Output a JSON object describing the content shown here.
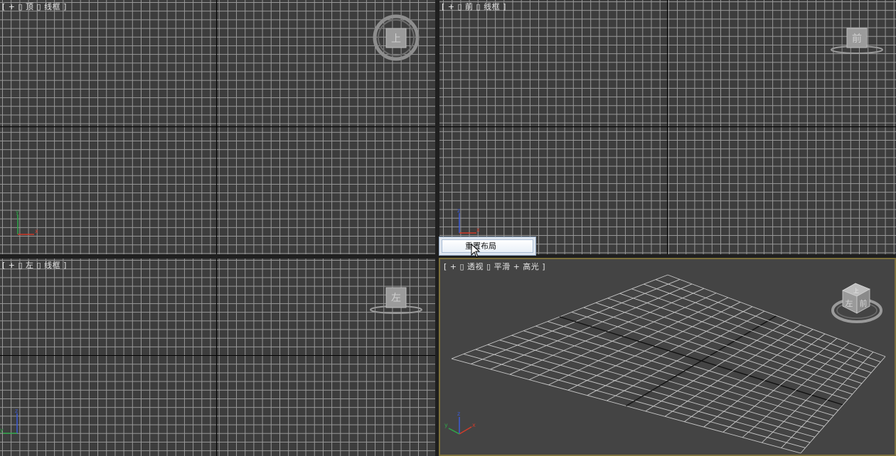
{
  "viewports": {
    "top": {
      "label": "[ + ▯ 顶 ▯ 线框 ]",
      "viewcube_face": "上"
    },
    "front": {
      "label": "[ + ▯ 前 ▯ 线框 ]",
      "viewcube_face": "前"
    },
    "left": {
      "label": "[ + ▯ 左 ▯ 线框 ]",
      "viewcube_face": "左"
    },
    "perspective": {
      "label": "[ + ▯ 透视 ▯ 平滑 + 高光 ]",
      "viewcube_face_front": "前",
      "viewcube_face_left": "左",
      "viewcube_face_top": "上"
    }
  },
  "context_menu": {
    "item": "重置布局"
  },
  "axis_labels": {
    "x": "x",
    "y": "y",
    "z": "z"
  },
  "colors": {
    "x_axis": "#d23b2a",
    "y_axis": "#2fa84a",
    "z_axis": "#3b5bd6",
    "active_border": "#7c6f3a"
  },
  "icons": {
    "cursor": "arrow-cursor-icon"
  }
}
